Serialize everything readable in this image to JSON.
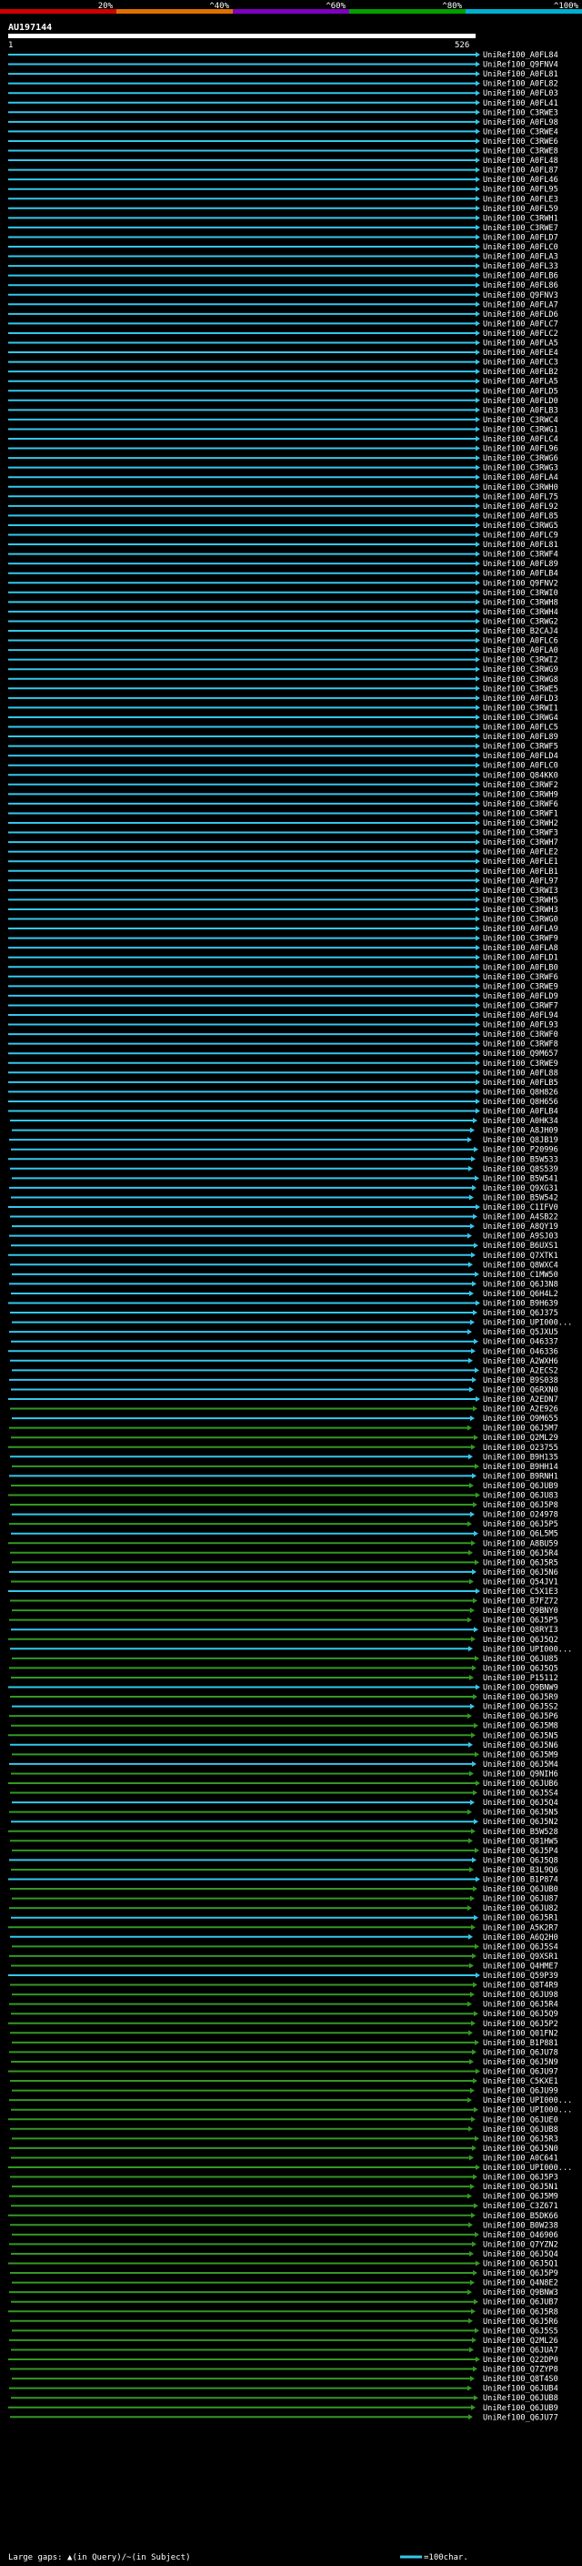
{
  "chart_data": {
    "type": "bar",
    "query": {
      "id": "AU197144",
      "start": "1",
      "end": "526",
      "length": 526
    },
    "score_scale": [
      {
        "label": "20%",
        "color": "#d00000"
      },
      {
        "label": "^40%",
        "color": "#e07000"
      },
      {
        "label": "^60%",
        "color": "#8000c0"
      },
      {
        "label": "^80%",
        "color": "#00a000"
      },
      {
        "label": "^100%",
        "color": "#00b0d0"
      }
    ],
    "colors": {
      "high": "#33c8ee",
      "mid": "#339922",
      "low": "#0a2a0a",
      "query": "#ffffff",
      "marker": "#ffff00"
    },
    "legend": {
      "gaps_text": "Large gaps: ▲(in Query)/~(in Subject)",
      "scale_text": "=100char."
    },
    "hits": [
      "UniRef100_A0FL84",
      "UniRef100_Q9FNV4",
      "UniRef100_A0FL81",
      "UniRef100_A0FL82",
      "UniRef100_A0FL03",
      "UniRef100_A0FL41",
      "UniRef100_C3RWE3",
      "UniRef100_A0FL98",
      "UniRef100_C3RWE4",
      "UniRef100_C3RWE6",
      "UniRef100_C3RWE8",
      "UniRef100_A0FL48",
      "UniRef100_A0FL87",
      "UniRef100_A0FL46",
      "UniRef100_A0FL95",
      "UniRef100_A0FLE3",
      "UniRef100_A0FL59",
      "UniRef100_C3RWH1",
      "UniRef100_C3RWE7",
      "UniRef100_A0FLD7",
      "UniRef100_A0FLC0",
      "UniRef100_A0FLA3",
      "UniRef100_A0FL33",
      "UniRef100_A0FLB6",
      "UniRef100_A0FL86",
      "UniRef100_Q9FNV3",
      "UniRef100_A0FLA7",
      "UniRef100_A0FLD6",
      "UniRef100_A0FLC7",
      "UniRef100_A0FLC2",
      "UniRef100_A0FLA5",
      "UniRef100_A0FLE4",
      "UniRef100_A0FLC3",
      "UniRef100_A0FLB2",
      "UniRef100_A0FLA5",
      "UniRef100_A0FLD5",
      "UniRef100_A0FLD0",
      "UniRef100_A0FLB3",
      "UniRef100_C3RWC4",
      "UniRef100_C3RWG1",
      "UniRef100_A0FLC4",
      "UniRef100_A0FL96",
      "UniRef100_C3RWG6",
      "UniRef100_C3RWG3",
      "UniRef100_A0FLA4",
      "UniRef100_C3RWH0",
      "UniRef100_A0FL75",
      "UniRef100_A0FL92",
      "UniRef100_A0FL85",
      "UniRef100_C3RWG5",
      "UniRef100_A0FLC9",
      "UniRef100_A0FL81",
      "UniRef100_C3RWF4",
      "UniRef100_A0FL89",
      "UniRef100_A0FLB4",
      "UniRef100_Q9FNV2",
      "UniRef100_C3RWI0",
      "UniRef100_C3RWH8",
      "UniRef100_C3RWH4",
      "UniRef100_C3RWG2",
      "UniRef100_B2CAJ4",
      "UniRef100_A0FLC6",
      "UniRef100_A0FLA0",
      "UniRef100_C3RWI2",
      "UniRef100_C3RWG9",
      "UniRef100_C3RWG8",
      "UniRef100_C3RWE5",
      "UniRef100_A0FLD3",
      "UniRef100_C3RWI1",
      "UniRef100_C3RWG4",
      "UniRef100_A0FLC5",
      "UniRef100_A0FL89",
      "UniRef100_C3RWF5",
      "UniRef100_A0FLD4",
      "UniRef100_A0FLC0",
      "UniRef100_Q84KK0",
      "UniRef100_C3RWF2",
      "UniRef100_C3RWH9",
      "UniRef100_C3RWF6",
      "UniRef100_C3RWF1",
      "UniRef100_C3RWH2",
      "UniRef100_C3RWF3",
      "UniRef100_C3RWH7",
      "UniRef100_A0FLE2",
      "UniRef100_A0FLE1",
      "UniRef100_A0FLB1",
      "UniRef100_A0FL97",
      "UniRef100_C3RWI3",
      "UniRef100_C3RWH5",
      "UniRef100_C3RWH3",
      "UniRef100_C3RWG0",
      "UniRef100_A0FLA9",
      "UniRef100_C3RWF9",
      "UniRef100_A0FLA8",
      "UniRef100_A0FLD1",
      "UniRef100_A0FLB0",
      "UniRef100_C3RWF6",
      "UniRef100_C3RWE9",
      "UniRef100_A0FLD9",
      "UniRef100_C3RWF7",
      "UniRef100_A0FL94",
      "UniRef100_A0FL93",
      "UniRef100_C3RWF0",
      "UniRef100_C3RWF8",
      "UniRef100_Q9M657",
      "UniRef100_C3RWE9",
      "UniRef100_A0FL88",
      "UniRef100_A0FLB5",
      "UniRef100_Q8H826",
      "UniRef100_Q8H656",
      "UniRef100_A0FLB4",
      "UniRef100_A0HK34",
      "UniRef100_A8JH09",
      "UniRef100_Q8JB19",
      "UniRef100_P20996",
      "UniRef100_B5W533",
      "UniRef100_Q8S539",
      "UniRef100_B5W541",
      "UniRef100_Q9XG31",
      "UniRef100_B5W542",
      "UniRef100_C1IFV0",
      "UniRef100_A4SB22",
      "UniRef100_A8QY19",
      "UniRef100_A9SJ03",
      "UniRef100_B6UXS1",
      "UniRef100_Q7XTK1",
      "UniRef100_Q8WXC4",
      "UniRef100_C1MW50",
      "UniRef100_Q6J3N8",
      "UniRef100_Q6H4L2",
      "UniRef100_B9H639",
      "UniRef100_Q6J375",
      "UniRef100_UPI000...",
      "UniRef100_Q5JXU5",
      "UniRef100_O46337",
      "UniRef100_O46336",
      "UniRef100_A2WXH6",
      "UniRef100_A2ECS2",
      "UniRef100_B9S038",
      "UniRef100_Q6RXN0",
      "UniRef100_A2EDN7",
      "UniRef100_A2E926",
      "UniRef100_O9M655",
      "UniRef100_Q6J5M7",
      "UniRef100_Q2ML29",
      "UniRef100_O23755",
      "UniRef100_B9H135",
      "UniRef100_B9HH14",
      "UniRef100_B9RNH1",
      "UniRef100_Q6JUB9",
      "UniRef100_Q6JU83",
      "UniRef100_Q6J5P8",
      "UniRef100_O24978",
      "UniRef100_Q6J5P5",
      "UniRef100_Q6L5M5",
      "UniRef100_A8BU59",
      "UniRef100_Q6J5R4",
      "UniRef100_Q6J5R5",
      "UniRef100_Q6J5N6",
      "UniRef100_Q54JV1",
      "UniRef100_C5X1E3",
      "UniRef100_B7FZ72",
      "UniRef100_Q9BNY0",
      "UniRef100_Q6J5P5",
      "UniRef100_Q8RYI3",
      "UniRef100_Q6J5Q2",
      "UniRef100_UPI000...",
      "UniRef100_Q6JU85",
      "UniRef100_Q6J5Q5",
      "UniRef100_P15112",
      "UniRef100_Q9BNW9",
      "UniRef100_Q6J5R9",
      "UniRef100_Q6J5S2",
      "UniRef100_Q6J5P6",
      "UniRef100_Q6J5M8",
      "UniRef100_Q6J5N5",
      "UniRef100_Q6J5N6",
      "UniRef100_Q6J5M9",
      "UniRef100_Q6J5M4",
      "UniRef100_Q9NIH6",
      "UniRef100_Q6JUB6",
      "UniRef100_Q6J5S4",
      "UniRef100_Q6J5Q4",
      "UniRef100_Q6J5N5",
      "UniRef100_Q6J5N2",
      "UniRef100_B5W528",
      "UniRef100_Q81HW5",
      "UniRef100_Q6J5P4",
      "UniRef100_Q6J5Q8",
      "UniRef100_B3L9Q6",
      "UniRef100_B1P874",
      "UniRef100_Q6JUB0",
      "UniRef100_Q6JU87",
      "UniRef100_Q6JU82",
      "UniRef100_Q6J5R1",
      "UniRef100_A5K2R7",
      "UniRef100_A6Q2H0",
      "UniRef100_Q6J5S4",
      "UniRef100_Q9XSR1",
      "UniRef100_Q4HME7",
      "UniRef100_Q59P39",
      "UniRef100_Q8T4R9",
      "UniRef100_Q6JU98",
      "UniRef100_Q6J5R4",
      "UniRef100_Q6J5Q9",
      "UniRef100_Q6J5P2",
      "UniRef100_Q01FN2",
      "UniRef100_B1P881",
      "UniRef100_Q6JU78",
      "UniRef100_Q6J5N9",
      "UniRef100_Q6JU97",
      "UniRef100_C5KXE1",
      "UniRef100_Q6JU99",
      "UniRef100_UPI000...",
      "UniRef100_UPI000...",
      "UniRef100_Q6JUE0",
      "UniRef100_Q6JUB8",
      "UniRef100_Q6J5R3",
      "UniRef100_Q6J5N0",
      "UniRef100_A0C641",
      "UniRef100_UPI000...",
      "UniRef100_Q6J5P3",
      "UniRef100_Q6J5N1",
      "UniRef100_Q6J5M9",
      "UniRef100_C3Z671",
      "UniRef100_B5DK66",
      "UniRef100_B0W238",
      "UniRef100_O46906",
      "UniRef100_Q7YZN2",
      "UniRef100_Q6J5Q4",
      "UniRef100_Q6J5Q1",
      "UniRef100_Q6J5P9",
      "UniRef100_Q4N8E2",
      "UniRef100_Q9BNW3",
      "UniRef100_Q6JUB7",
      "UniRef100_Q6J5R8",
      "UniRef100_Q6J5R6",
      "UniRef100_Q6J5S5",
      "UniRef100_Q2ML26",
      "UniRef100_Q6JUA7",
      "UniRef100_Q22DP0",
      "UniRef100_Q7ZYP8",
      "UniRef100_Q8T4S0",
      "UniRef100_Q6JUB4",
      "UniRef100_Q6JUB8",
      "UniRef100_Q6JUB9",
      "UniRef100_Q6JU77"
    ]
  }
}
